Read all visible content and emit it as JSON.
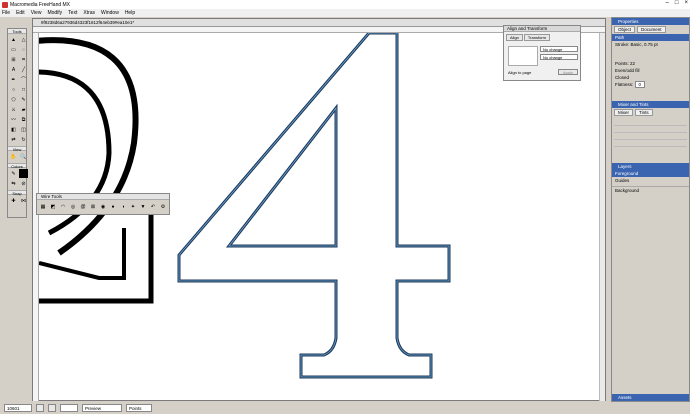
{
  "app": {
    "title": "Macromedia FreeHand MX",
    "window_buttons": [
      "–",
      "□",
      "×"
    ]
  },
  "menu": [
    "File",
    "Edit",
    "View",
    "Modify",
    "Text",
    "Xtras",
    "Window",
    "Help"
  ],
  "toolbox": {
    "header": "Tools",
    "view_header": "View",
    "colors_header": "Colors",
    "snap_header": "Snap"
  },
  "document": {
    "title": "9f9238d6a27936d4323f1612f64eb39#ea10e1*"
  },
  "wintools": {
    "title": "Wire Tools"
  },
  "align_panel": {
    "title": "Align and Transform",
    "tabs": [
      "Align",
      "Transform"
    ],
    "dropdown_1": "No change",
    "dropdown_2": "No change",
    "checkbox": "Align to page",
    "apply": "Apply"
  },
  "properties_panel": {
    "title": "Properties",
    "tabs": [
      "Object",
      "Document"
    ],
    "selected_item": "Path",
    "sub_item": "Stroke: Basic, 0.75 pt",
    "points_label": "Points:",
    "points_value": "22",
    "even_odd": "Even/odd fill",
    "closed": "Closed",
    "flatness_label": "Flatness:",
    "flatness_value": "0"
  },
  "mixer_panel": {
    "title": "Mixer and Tints",
    "tabs": [
      "Mixer",
      "Tints"
    ]
  },
  "layers_panel": {
    "title": "Layers",
    "layers": [
      "Foreground",
      "Guides",
      "Background"
    ]
  },
  "assets_panel": {
    "title": "Assets"
  },
  "statusbar": {
    "page": "10601",
    "preview": "Preview",
    "units": "Points"
  },
  "colors": {
    "accent": "#3a64b0",
    "stroke": "#1e3a5a"
  }
}
